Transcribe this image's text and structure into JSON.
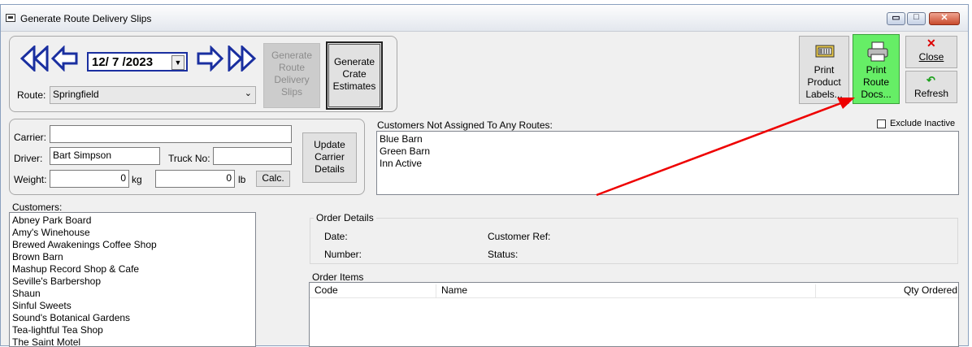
{
  "window": {
    "title": "Generate Route Delivery Slips"
  },
  "titlebar_buttons": {
    "minimize": "▭",
    "maximize": "□",
    "close": "✕"
  },
  "date_nav": {
    "date": "12/ 7 /2023"
  },
  "route": {
    "label": "Route:",
    "value": "Springfield"
  },
  "buttons": {
    "generate_slips": "Generate Route Delivery Slips",
    "generate_crates": "Generate Crate Estimates",
    "print_labels": "Print Product Labels...",
    "print_route": "Print Route Docs...",
    "close": "Close",
    "refresh": "Refresh",
    "update_carrier": "Update Carrier Details",
    "calc": "Calc."
  },
  "carrier": {
    "carrier_label": "Carrier:",
    "carrier_value": "",
    "driver_label": "Driver:",
    "driver_value": "Bart Simpson",
    "truck_label": "Truck No:",
    "truck_value": "",
    "weight_label": "Weight:",
    "weight_kg": "0",
    "kg_unit": "kg",
    "weight_lb": "0",
    "lb_unit": "lb"
  },
  "unassigned": {
    "label": "Customers Not Assigned To Any Routes:",
    "exclude_inactive": "Exclude Inactive",
    "items": [
      "Blue Barn",
      "Green Barn",
      "Inn Active"
    ]
  },
  "customers": {
    "label": "Customers:",
    "items": [
      "Abney Park Board",
      "Amy's Winehouse",
      "Brewed Awakenings Coffee Shop",
      "Brown Barn",
      "Mashup Record Shop & Cafe",
      "Seville's Barbershop",
      "Shaun",
      "Sinful Sweets",
      "Sound's Botanical Gardens",
      "Tea-lightful Tea Shop",
      "The Saint Motel"
    ]
  },
  "order_details": {
    "label": "Order Details",
    "date_label": "Date:",
    "number_label": "Number:",
    "customer_ref_label": "Customer Ref:",
    "status_label": "Status:"
  },
  "order_items": {
    "label": "Order Items",
    "columns": [
      "Code",
      "Name",
      "Qty Ordered"
    ]
  },
  "colors": {
    "highlight_button": "#66ee66",
    "arrow": "#ee0000",
    "nav_arrow": "#1a2fa0"
  }
}
